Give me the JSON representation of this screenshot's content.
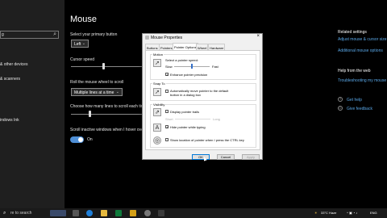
{
  "settings": {
    "search_value": "g",
    "nav": [
      "& other devices",
      "& scanners",
      "indows Ink"
    ],
    "title": "Mouse",
    "primary_button_label": "Select your primary button",
    "primary_button_value": "Left",
    "cursor_speed_label": "Cursor speed",
    "cursor_speed_level": 0.45,
    "roll_label": "Roll the mouse wheel to scroll",
    "roll_value": "Multiple lines at a time",
    "lines_label": "Choose how many lines to scroll each tim",
    "inactive_label": "Scroll inactive windows when I hover ove",
    "inactive_state": "On",
    "related_title": "Related settings",
    "related_links": [
      "Adjust mouse & cursor size",
      "Additional mouse options"
    ],
    "help_title": "Help from the web",
    "help_link": "Troubleshooting my mouse",
    "get_help": "Get help",
    "give_feedback": "Give feedback"
  },
  "dialog": {
    "title": "Mouse Properties",
    "close": "×",
    "tabs": [
      "Buttons",
      "Pointers",
      "Pointer Options",
      "Wheel",
      "Hardware"
    ],
    "active_tab": "Pointer Options",
    "motion": {
      "title": "Motion",
      "speed_label": "Select a pointer speed:",
      "slow": "Slow",
      "fast": "Fast",
      "speed_level": 0.5,
      "precision_label": "Enhance pointer precision",
      "precision_checked": true
    },
    "snap": {
      "title": "Snap To",
      "label": "Automatically move pointer to the default button in a dialog box",
      "checked": false
    },
    "visibility": {
      "title": "Visibility",
      "trails_label": "Display pointer trails",
      "trails_checked": false,
      "short": "Short",
      "long": "Long",
      "hide_label": "Hide pointer while typing",
      "hide_checked": true,
      "ctrl_label": "Show location of pointer when I press the CTRL key",
      "ctrl_checked": false
    },
    "buttons": {
      "ok": "OK",
      "cancel": "Cancel",
      "apply": "Apply"
    }
  },
  "taskbar": {
    "search_placeholder": "re to search",
    "weather": "33°C  Haze",
    "lang": "ENG"
  },
  "colors": {
    "accent": "#4f8fd6",
    "link": "#5aa8e8",
    "dialog_bg": "#f0f0f0"
  }
}
